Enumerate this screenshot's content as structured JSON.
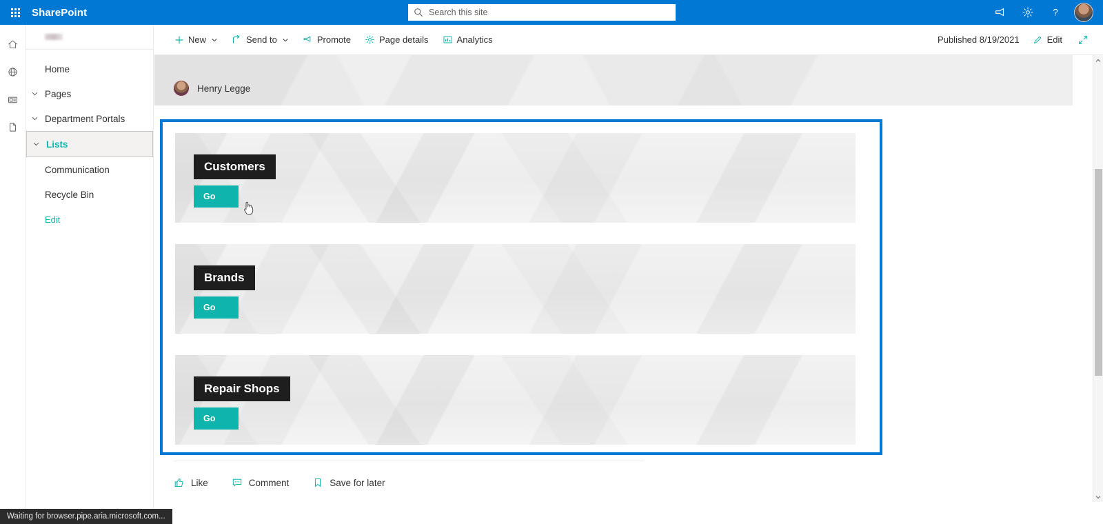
{
  "suite": {
    "brand": "SharePoint",
    "waffle_icon": "waffle-grid-icon",
    "search": {
      "placeholder": "Search this site",
      "value": "",
      "icon": "search-icon"
    },
    "icons": [
      {
        "name": "feedback-megaphone-icon",
        "label": "Feedback"
      },
      {
        "name": "gear-icon",
        "label": "Settings"
      },
      {
        "name": "help-question-icon",
        "label": "Help"
      }
    ],
    "avatar": "user-avatar",
    "background_color": "#0078D4"
  },
  "app_rail": {
    "items": [
      {
        "name": "home-icon",
        "label": "Home"
      },
      {
        "name": "globe-icon",
        "label": "Sites"
      },
      {
        "name": "news-icon",
        "label": "News"
      },
      {
        "name": "page-icon",
        "label": "Pages"
      }
    ]
  },
  "site_nav": {
    "logo": "site-logo-redacted",
    "items": [
      {
        "label": "Home",
        "has_chevron": false,
        "selected": false
      },
      {
        "label": "Pages",
        "has_chevron": true,
        "selected": false
      },
      {
        "label": "Department Portals",
        "has_chevron": true,
        "selected": false
      },
      {
        "label": "Lists",
        "has_chevron": true,
        "selected": true
      },
      {
        "label": "Communication",
        "has_chevron": false,
        "selected": false
      },
      {
        "label": "Recycle Bin",
        "has_chevron": false,
        "selected": false
      }
    ],
    "edit_link": "Edit"
  },
  "command_bar": {
    "buttons": [
      {
        "label": "New",
        "icon": "plus-icon",
        "chevron": true
      },
      {
        "label": "Send to",
        "icon": "share-icon",
        "chevron": true
      },
      {
        "label": "Promote",
        "icon": "promote-megaphone-icon",
        "chevron": false
      },
      {
        "label": "Page details",
        "icon": "page-details-gear-icon",
        "chevron": false
      },
      {
        "label": "Analytics",
        "icon": "analytics-chart-icon",
        "chevron": false
      }
    ],
    "published_status": "Published 8/19/2021",
    "edit_label": "Edit",
    "edit_icon": "pencil-icon",
    "expand_icon": "expand-diagonal-icon"
  },
  "page": {
    "byline": {
      "author": "Henry Legge",
      "avatar": "author-avatar"
    },
    "webpart": {
      "selected": true,
      "selection_color": "#0078D4",
      "cards": [
        {
          "title": "Customers",
          "button_label": "Go"
        },
        {
          "title": "Brands",
          "button_label": "Go"
        },
        {
          "title": "Repair Shops",
          "button_label": "Go"
        }
      ],
      "accent_color": "#0FB5AD",
      "title_bg_color": "#1E1E1E"
    },
    "actions": [
      {
        "label": "Like",
        "icon": "thumbs-up-icon"
      },
      {
        "label": "Comment",
        "icon": "comment-bubble-icon"
      },
      {
        "label": "Save for later",
        "icon": "bookmark-icon"
      }
    ]
  },
  "browser": {
    "status_text": "Waiting for browser.pipe.aria.microsoft.com..."
  },
  "cursor": {
    "type": "pointer-hand"
  }
}
